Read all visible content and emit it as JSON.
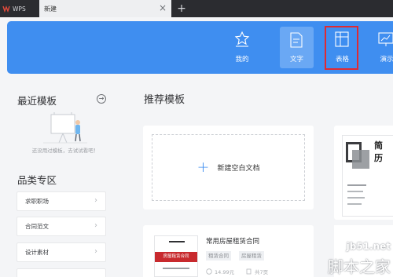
{
  "titlebar": {
    "app_label": "WPS",
    "doc_tab": "新建",
    "close_glyph": "×",
    "new_tab_glyph": "+"
  },
  "ribbon": {
    "color": "#3f8ef0",
    "highlight_color": "#e02a32",
    "categories": [
      {
        "label": "我的",
        "icon": "star-doc-icon"
      },
      {
        "label": "文字",
        "icon": "writer-doc-icon",
        "active": true
      },
      {
        "label": "表格",
        "icon": "spreadsheet-icon",
        "highlighted": true
      },
      {
        "label": "演示",
        "icon": "presentation-icon"
      }
    ]
  },
  "sidebar": {
    "recent_title": "最近模板",
    "recent_arrow": "→",
    "empty_tip": "还没用过模板，去试试看吧！",
    "category_title": "品类专区",
    "chevron": "›",
    "categories": [
      "求职职场",
      "合同范文",
      "设计素材"
    ]
  },
  "main": {
    "title": "推荐模板",
    "blank_plus": "+",
    "blank_label": "新建空白文档",
    "resume_thumb_text": "简\n历",
    "contract": {
      "title": "常用房屋租赁合同",
      "thumb_text": "房屋租赁合同",
      "tags": [
        "租赁合同",
        "房屋租赁"
      ],
      "price": "14.99元",
      "pages": "共7页"
    }
  },
  "watermark": {
    "url": "jb51.net",
    "name": "脚本之家"
  }
}
